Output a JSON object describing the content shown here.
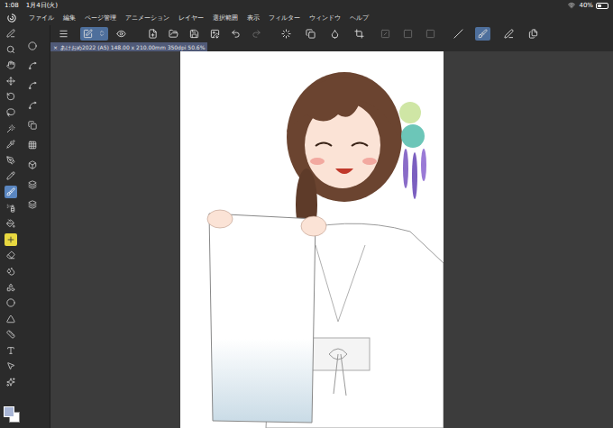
{
  "status_bar": {
    "time": "1:08",
    "date": "1月4日(火)",
    "battery": "40%",
    "battery_level": 0.4
  },
  "menu": [
    "ファイル",
    "編集",
    "ページ管理",
    "アニメーション",
    "レイヤー",
    "選択範囲",
    "表示",
    "フィルター",
    "ウィンドウ",
    "ヘルプ"
  ],
  "toolbar": [
    {
      "selected": false,
      "disabled": false
    },
    {
      "selected": true,
      "disabled": false
    },
    {
      "selected": false,
      "disabled": false
    },
    {
      "selected": false,
      "disabled": false
    },
    {
      "selected": false,
      "disabled": false
    },
    {
      "selected": false,
      "disabled": false
    },
    {
      "selected": false,
      "disabled": false
    },
    {
      "selected": false,
      "disabled": false
    },
    {
      "selected": false,
      "disabled": true
    },
    {
      "selected": false,
      "disabled": false
    },
    {
      "selected": false,
      "disabled": false
    },
    {
      "selected": false,
      "disabled": false
    },
    {
      "selected": false,
      "disabled": false
    },
    {
      "selected": false,
      "disabled": true
    },
    {
      "selected": false,
      "disabled": true
    },
    {
      "selected": false,
      "disabled": true
    },
    {
      "selected": false,
      "disabled": false
    },
    {
      "selected": true,
      "disabled": false
    },
    {
      "selected": false,
      "disabled": false
    },
    {
      "selected": false,
      "disabled": false
    }
  ],
  "canvas_tab": {
    "close": "×",
    "title": "あけおめ2022 (A5) 148.00 x 210.00mm 350dpi 50.6%"
  },
  "tools": [
    {
      "selected": false
    },
    {
      "selected": false
    },
    {
      "selected": false
    },
    {
      "selected": false
    },
    {
      "selected": false
    },
    {
      "selected": false
    },
    {
      "selected": false
    },
    {
      "selected": false
    },
    {
      "selected": false
    },
    {
      "selected": false
    },
    {
      "selected": true
    },
    {
      "selected": false
    },
    {
      "selected": false
    },
    {
      "selected": false
    },
    {
      "selected": false
    },
    {
      "selected": false
    },
    {
      "selected": false
    },
    {
      "selected": false
    },
    {
      "selected": false
    },
    {
      "selected": false
    },
    {
      "selected": false
    },
    {
      "selected": false
    },
    {
      "selected": false
    }
  ],
  "sub_tools": [
    {
      "selected": false
    },
    {
      "selected": false
    },
    {
      "selected": false
    },
    {
      "selected": false
    },
    {
      "selected": false
    },
    {
      "selected": false
    },
    {
      "selected": false
    },
    {
      "selected": false
    },
    {
      "selected": false
    }
  ],
  "colors": {
    "main": "#a9b6d6",
    "sub": "#ffffff"
  }
}
